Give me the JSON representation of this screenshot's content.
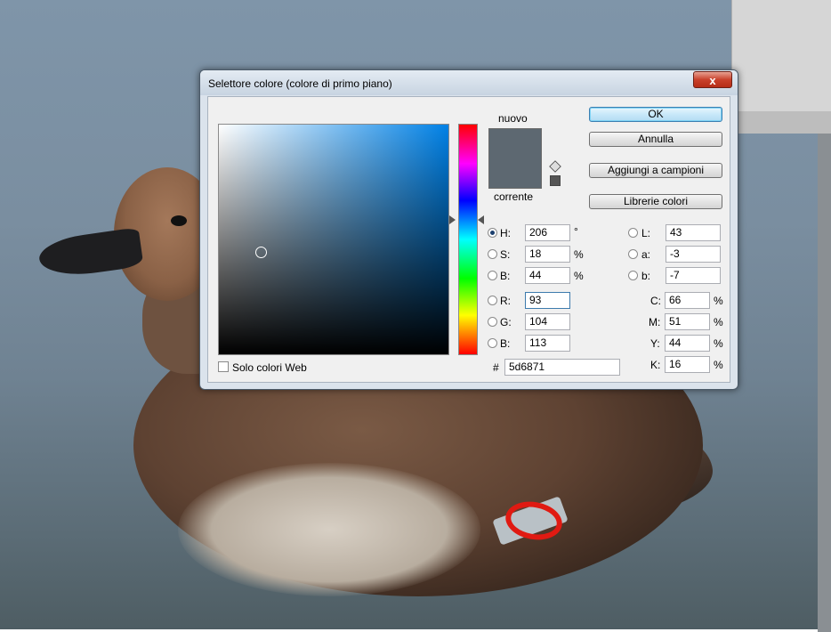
{
  "dialog": {
    "title": "Selettore colore (colore di primo piano)",
    "close_glyph": "x"
  },
  "swatch": {
    "new_label": "nuovo",
    "current_label": "corrente",
    "new_color": "#5d6871",
    "current_color": "#5d6871"
  },
  "buttons": {
    "ok": "OK",
    "cancel": "Annulla",
    "add_to_swatches": "Aggiungi a campioni",
    "color_libraries": "Librerie colori"
  },
  "hsb": {
    "h_label": "H:",
    "h_value": "206",
    "h_unit": "°",
    "s_label": "S:",
    "s_value": "18",
    "s_unit": "%",
    "b_label": "B:",
    "b_value": "44",
    "b_unit": "%"
  },
  "rgb": {
    "r_label": "R:",
    "r_value": "93",
    "g_label": "G:",
    "g_value": "104",
    "b_label": "B:",
    "b_value": "113"
  },
  "lab": {
    "l_label": "L:",
    "l_value": "43",
    "a_label": "a:",
    "a_value": "-3",
    "b_label": "b:",
    "b_value": "-7"
  },
  "cmyk": {
    "c_label": "C:",
    "c_value": "66",
    "c_unit": "%",
    "m_label": "M:",
    "m_value": "51",
    "m_unit": "%",
    "y_label": "Y:",
    "y_value": "44",
    "y_unit": "%",
    "k_label": "K:",
    "k_value": "16",
    "k_unit": "%"
  },
  "hex": {
    "label": "#",
    "value": "5d6871"
  },
  "web_only": {
    "label": "Solo colori Web",
    "checked": false
  },
  "selected_mode": "H",
  "colors": {
    "picker_hue": "#0081e6",
    "annotation_mark": "#e01a12"
  }
}
